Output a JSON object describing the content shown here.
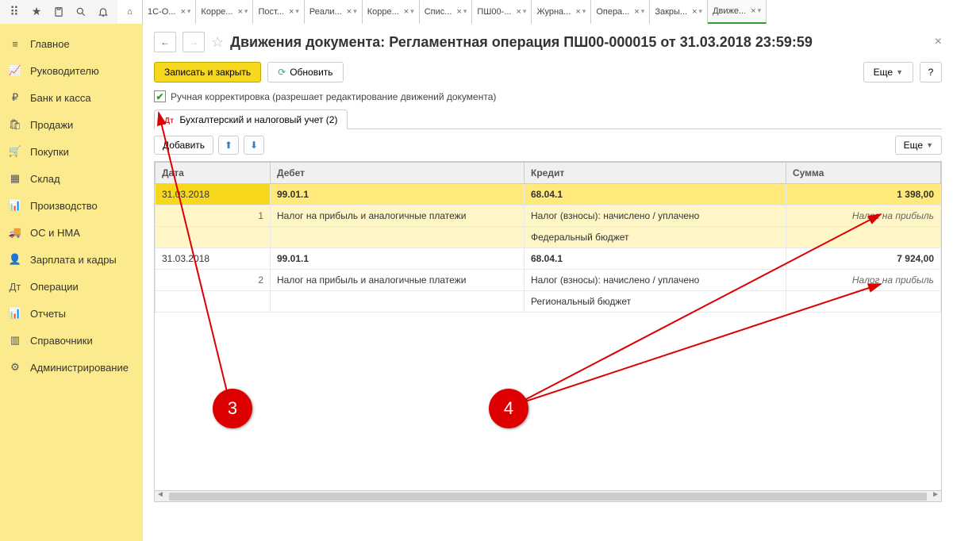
{
  "top_icons": {
    "grid": "⋮⋮⋮",
    "star": "★",
    "clip": "📋",
    "search": "🔍",
    "bell": "🔔"
  },
  "tabs": [
    {
      "label": "",
      "home": true
    },
    {
      "label": "1С-О..."
    },
    {
      "label": "Корре..."
    },
    {
      "label": "Пост..."
    },
    {
      "label": "Реали..."
    },
    {
      "label": "Корре..."
    },
    {
      "label": "Спис..."
    },
    {
      "label": "ПШ00-..."
    },
    {
      "label": "Журна..."
    },
    {
      "label": "Опера..."
    },
    {
      "label": "Закры..."
    },
    {
      "label": "Движе...",
      "active": true
    }
  ],
  "sidebar": [
    {
      "icon": "≡",
      "label": "Главное"
    },
    {
      "icon": "📈",
      "label": "Руководителю"
    },
    {
      "icon": "₽",
      "label": "Банк и касса"
    },
    {
      "icon": "🛍",
      "label": "Продажи"
    },
    {
      "icon": "🛒",
      "label": "Покупки"
    },
    {
      "icon": "▦",
      "label": "Склад"
    },
    {
      "icon": "📊",
      "label": "Производство"
    },
    {
      "icon": "🚚",
      "label": "ОС и НМА"
    },
    {
      "icon": "👤",
      "label": "Зарплата и кадры"
    },
    {
      "icon": "Дт",
      "label": "Операции"
    },
    {
      "icon": "📊",
      "label": "Отчеты"
    },
    {
      "icon": "▥",
      "label": "Справочники"
    },
    {
      "icon": "⚙",
      "label": "Администрирование"
    }
  ],
  "header": {
    "title": "Движения документа: Регламентная операция ПШ00-000015 от 31.03.2018 23:59:59"
  },
  "toolbar": {
    "save_close": "Записать и закрыть",
    "refresh": "Обновить",
    "more": "Еще",
    "help": "?"
  },
  "checkbox_label": "Ручная корректировка (разрешает редактирование движений документа)",
  "subtab_label": "Бухгалтерский и налоговый учет (2)",
  "table_toolbar": {
    "add": "Добавить",
    "more": "Еще"
  },
  "columns": {
    "date": "Дата",
    "debit": "Дебет",
    "credit": "Кредит",
    "sum": "Сумма"
  },
  "rows": [
    {
      "date": "31.03.2018",
      "index": "1",
      "debit_acc": "99.01.1",
      "debit_desc": "Налог на прибыль и аналогичные платежи",
      "credit_acc": "68.04.1",
      "credit_desc": "Налог (взносы): начислено / уплачено",
      "credit_desc2": "Федеральный бюджет",
      "sum": "1 398,00",
      "sum_note": "Налог на прибыль",
      "selected": true
    },
    {
      "date": "31.03.2018",
      "index": "2",
      "debit_acc": "99.01.1",
      "debit_desc": "Налог на прибыль и аналогичные платежи",
      "credit_acc": "68.04.1",
      "credit_desc": "Налог (взносы): начислено / уплачено",
      "credit_desc2": "Региональный бюджет",
      "sum": "7 924,00",
      "sum_note": "Налог на прибыль",
      "selected": false
    }
  ],
  "callouts": {
    "c3": "3",
    "c4": "4"
  }
}
